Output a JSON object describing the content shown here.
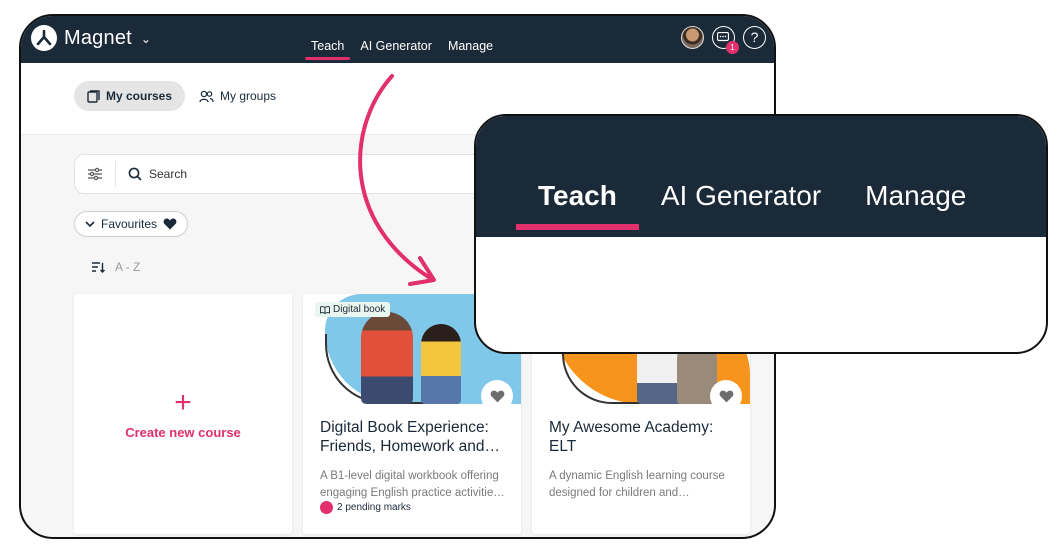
{
  "app": {
    "name": "Magnet",
    "nav": [
      "Teach",
      "AI Generator",
      "Manage"
    ],
    "active_nav": "Teach",
    "notification_count": "1",
    "help_glyph": "?"
  },
  "subnav": {
    "my_courses": "My courses",
    "my_groups": "My groups"
  },
  "search": {
    "placeholder": "Search"
  },
  "filters": {
    "favourites": "Favourites",
    "sort_label": "A - Z"
  },
  "cards": {
    "create": {
      "plus": "+",
      "label": "Create new course"
    },
    "items": [
      {
        "tag": "Digital book",
        "title_line1": "Digital Book Experience:",
        "title_line2": "Friends, Homework and…",
        "desc_line1": "A B1-level digital workbook offering",
        "desc_line2": "engaging English practice activitie…",
        "pending": "2 pending marks"
      },
      {
        "title_line1": "My Awesome Academy:",
        "title_line2": "ELT",
        "desc_line1": "A dynamic English learning course",
        "desc_line2": "designed for children and…"
      }
    ]
  },
  "zoom": {
    "nav": [
      "Teach",
      "AI Generator",
      "Manage"
    ]
  },
  "colors": {
    "topbar": "#1b2a38",
    "accent": "#e2306c",
    "card1_bg": "#7fc8ea",
    "card2_bg": "#f7941d"
  }
}
